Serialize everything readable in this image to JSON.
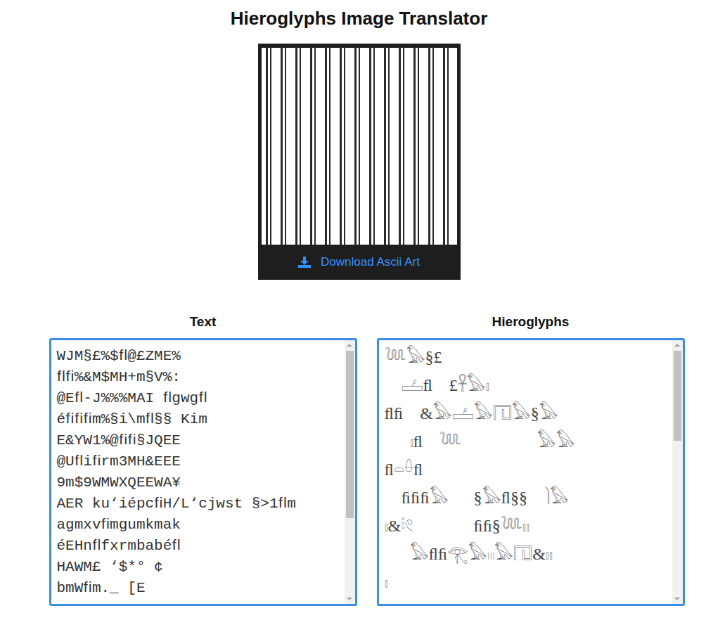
{
  "title": "Hieroglyphs Image Translator",
  "image_card": {
    "button": {
      "label": "Download Ascii Art"
    }
  },
  "text_panel": {
    "label": "Text",
    "lines": [
      "WJM§£%$ﬂ@£ZME%",
      "ﬂﬁ%&M$MH+m§V%:",
      "@Eﬂ-J%%%MAI ﬂgwgﬂ",
      "éﬁﬁﬁm%§i\\mﬂ§§ Kim",
      "E&YW1%@ﬁﬁ§JQEE",
      "@Uﬂiﬁrm3MH&EEE",
      "9m$9WMWXQEEWA¥",
      "AER ku‘iépcﬁH/L‘cjwst §>1ﬂm",
      "agmxvﬁmgumkmak",
      "éEHnﬂfxrmbabéﬂ",
      "HAWM£ ‘$*° ¢",
      "bmWﬁm._ [E"
    ],
    "scroll": {
      "level": 0.69
    }
  },
  "hieroglyph_panel": {
    "label": "Hieroglyphs",
    "lines": [
      "𓆙𓅃§£",
      "    𓐟ﬂ    £𓋹𓅃𓏤",
      "ﬂﬁ    &𓅃𓐟𓅃𓉔𓅃§𓅃",
      "      𓏤ﬂ    𓆙                  𓅃𓅃",
      "ﬂ𓏏𓏐ﬂ",
      "    ﬁﬁﬁ𓅃      §𓅃ﬂ§§    𓌙𓅃",
      "𓏤&𓏬𓏲              ﬁﬁ§𓆙𓏤𓏤",
      "      𓅃ﬂﬁ𓂀𓅃𓏼𓅃𓉔&𓏤𓏤",
      "𓏤"
    ],
    "scroll": {
      "level": 0.37
    }
  }
}
